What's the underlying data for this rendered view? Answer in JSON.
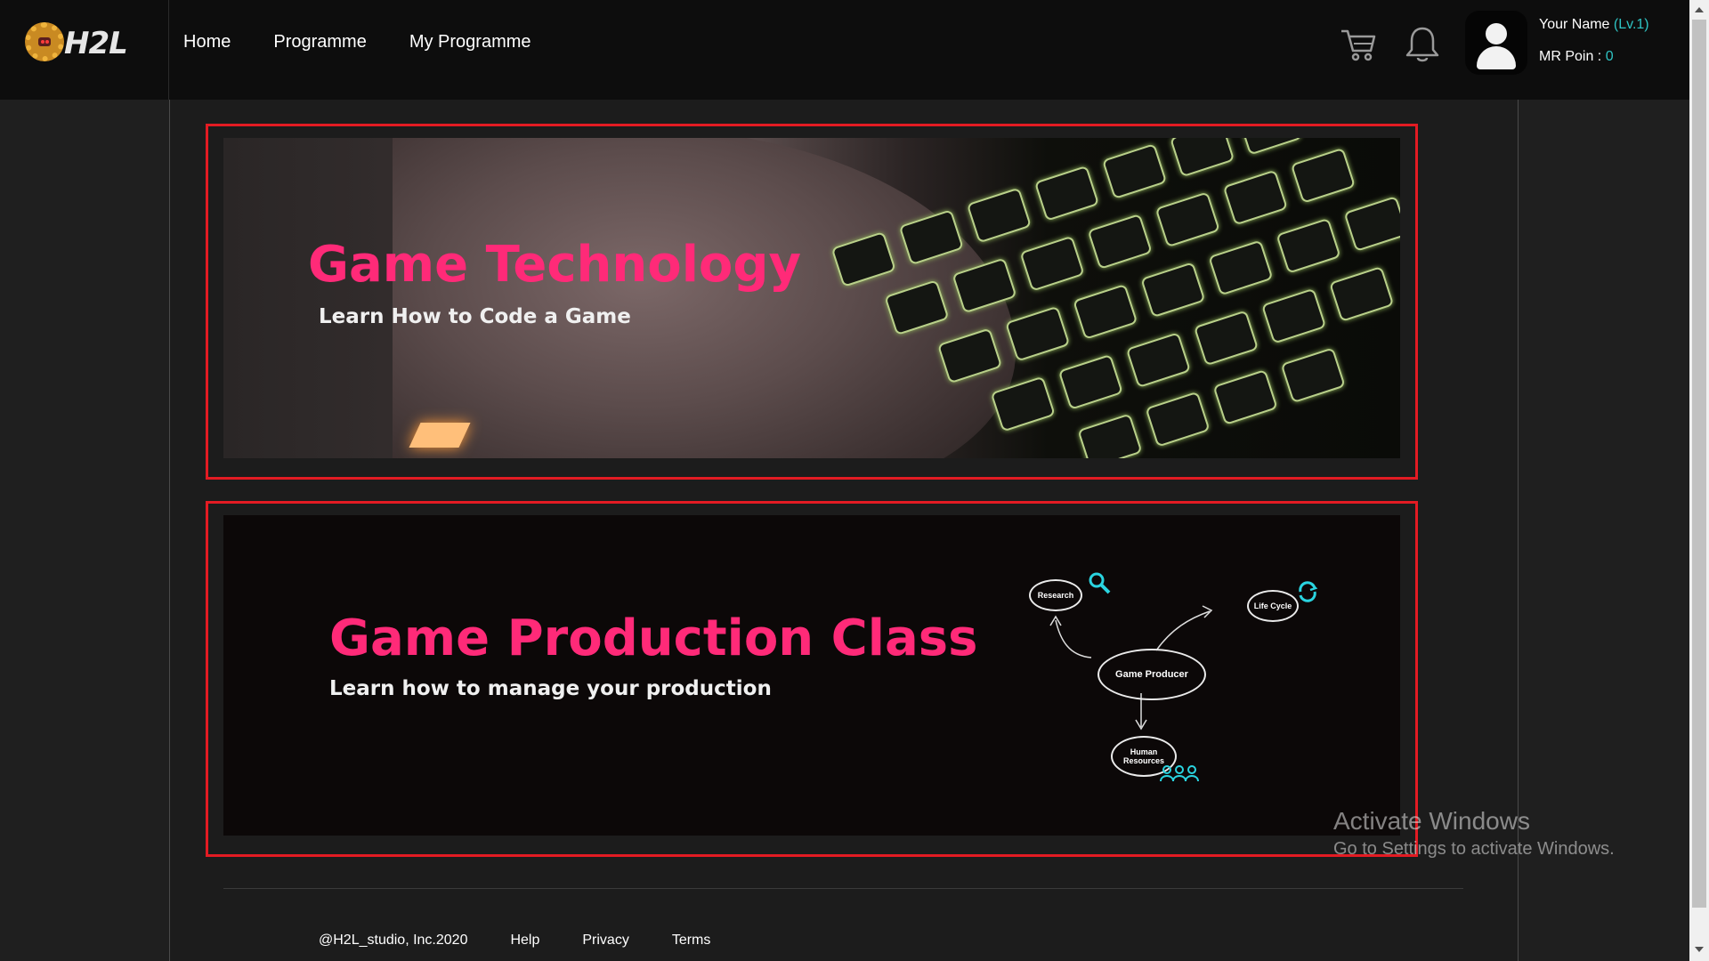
{
  "brand": {
    "logo_text": "H2L"
  },
  "nav": {
    "items": [
      "Home",
      "Programme",
      "My Programme"
    ]
  },
  "user": {
    "name": "Your Name",
    "level": "Lv.1",
    "points_label": "MR Poin :",
    "points": "0"
  },
  "programmes": [
    {
      "title": "Game Technology",
      "subtitle": "Learn How to Code a Game"
    },
    {
      "title": "Game Production Class",
      "subtitle": "Learn how to manage your production",
      "diagram": {
        "center": "Game Producer",
        "nodes": [
          "Research",
          "Life Cycle",
          "Human Resources"
        ]
      }
    }
  ],
  "footer": {
    "copyright": "@H2L_studio, Inc.2020",
    "links": [
      "Help",
      "Privacy",
      "Terms"
    ]
  },
  "watermark": {
    "line1": "Activate Windows",
    "line2": "Go to Settings to activate Windows."
  },
  "colors": {
    "accent_pink": "#ff2a78",
    "accent_teal": "#2ec4c4",
    "highlight_red": "#e31b23"
  },
  "icons": [
    "cart-icon",
    "bell-icon",
    "user-avatar-icon"
  ]
}
